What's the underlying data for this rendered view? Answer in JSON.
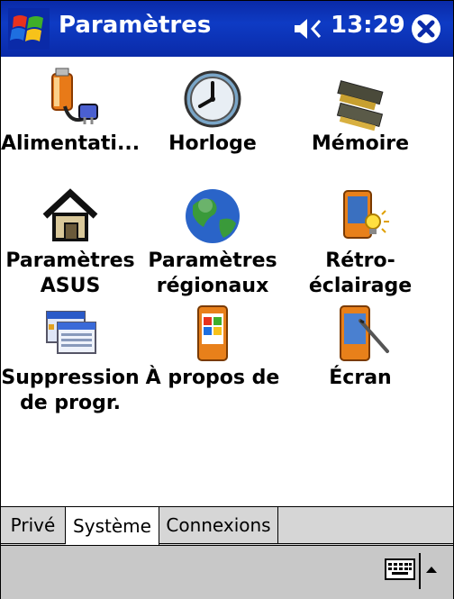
{
  "titlebar": {
    "title": "Paramètres",
    "time": "13:29"
  },
  "icons": [
    {
      "label": "Alimentati...",
      "icon": "battery-power-icon"
    },
    {
      "label": "Horloge",
      "icon": "clock-icon"
    },
    {
      "label": "Mémoire",
      "icon": "memory-chip-icon"
    },
    {
      "label": "Paramètres\nASUS",
      "icon": "house-icon"
    },
    {
      "label": "Paramètres\nrégionaux",
      "icon": "globe-icon"
    },
    {
      "label": "Rétro-\néclairage",
      "icon": "backlight-icon"
    },
    {
      "label": "Suppression\nde progr.",
      "icon": "remove-programs-icon"
    },
    {
      "label": "À propos de",
      "icon": "about-device-icon"
    },
    {
      "label": "Écran",
      "icon": "screen-stylus-icon"
    }
  ],
  "tabs": [
    {
      "label": "Privé",
      "active": false
    },
    {
      "label": "Système",
      "active": true
    },
    {
      "label": "Connexions",
      "active": false
    }
  ],
  "colors": {
    "titlebar": "#0a2aa8",
    "tabbar": "#d6d6d6",
    "menubar": "#c8c8c8"
  }
}
